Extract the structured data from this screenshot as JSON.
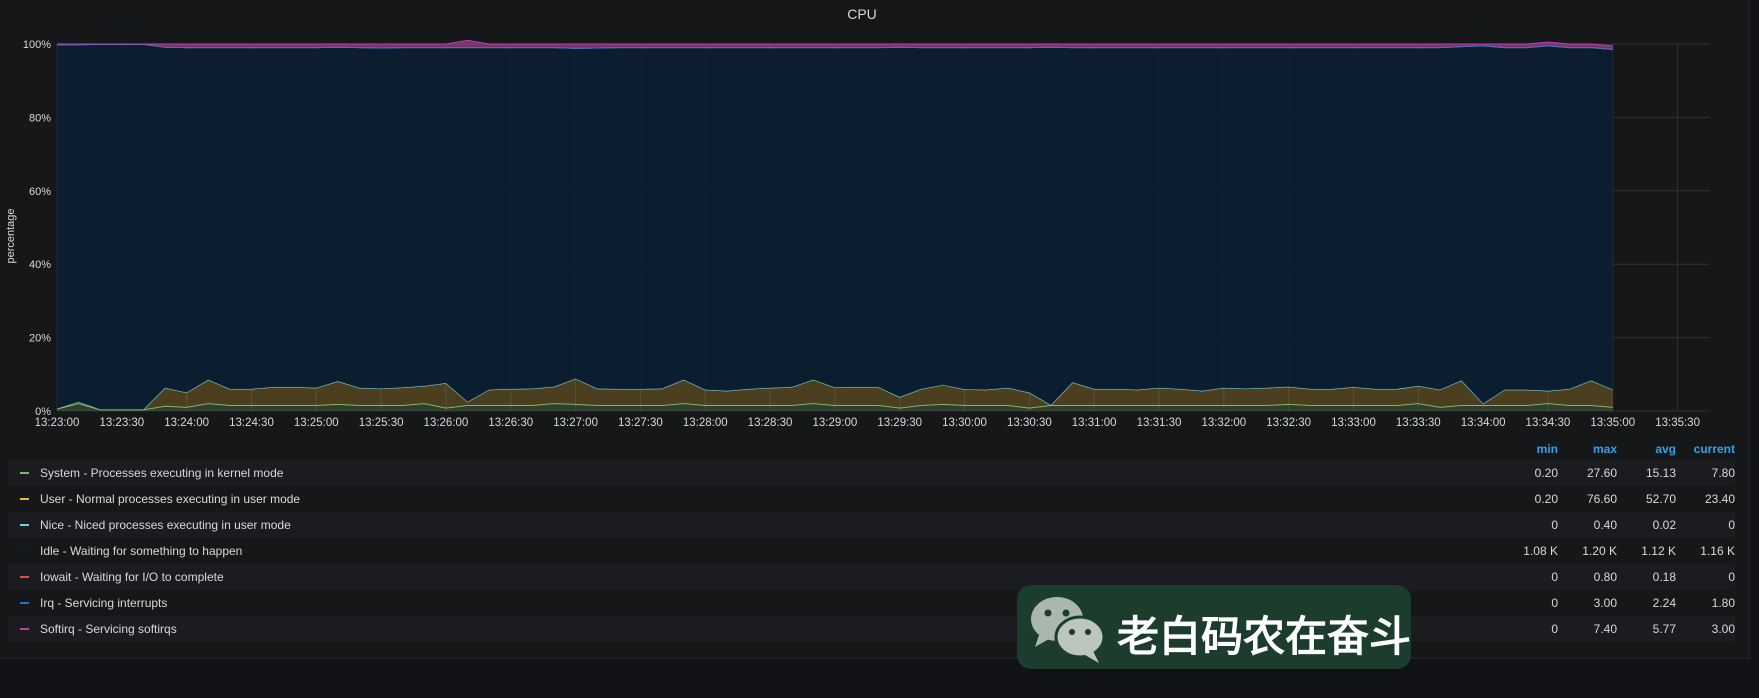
{
  "panel": {
    "title": "CPU"
  },
  "chart_data": {
    "type": "area",
    "title": "CPU",
    "ylabel": "percentage",
    "xlabel": "",
    "ylim": [
      0,
      100
    ],
    "yticks": [
      "0%",
      "20%",
      "40%",
      "60%",
      "80%",
      "100%"
    ],
    "xticks": [
      "13:23:00",
      "13:23:30",
      "13:24:00",
      "13:24:30",
      "13:25:00",
      "13:25:30",
      "13:26:00",
      "13:26:30",
      "13:27:00",
      "13:27:30",
      "13:28:00",
      "13:28:30",
      "13:29:00",
      "13:29:30",
      "13:30:00",
      "13:30:30",
      "13:31:00",
      "13:31:30",
      "13:32:00",
      "13:32:30",
      "13:33:00",
      "13:33:30",
      "13:34:00",
      "13:34:30",
      "13:35:00",
      "13:35:30"
    ],
    "x_start": "13:23:00",
    "x_end": "13:35:45",
    "x_step_seconds": 10,
    "stacked": true,
    "grid": true,
    "series": [
      {
        "name": "System - Processes executing in kernel mode",
        "color": "#7eb26d",
        "values": [
          0.5,
          2.0,
          0.3,
          0.3,
          0.3,
          1.3,
          1.0,
          2.0,
          1.5,
          1.5,
          1.5,
          1.5,
          1.5,
          1.8,
          1.5,
          1.5,
          1.5,
          2.0,
          0.8,
          1.5,
          1.5,
          1.5,
          1.5,
          2.0,
          1.8,
          1.5,
          1.5,
          1.5,
          1.5,
          2.0,
          1.5,
          1.5,
          1.5,
          1.5,
          1.5,
          2.0,
          1.5,
          1.5,
          1.5,
          0.8,
          1.5,
          1.8,
          1.5,
          1.5,
          1.5,
          0.8,
          1.5,
          1.5,
          1.5,
          1.5,
          1.5,
          1.5,
          1.5,
          1.5,
          1.5,
          1.5,
          1.5,
          1.8,
          1.5,
          1.5,
          1.5,
          1.5,
          1.5,
          2.0,
          1.0,
          1.5,
          1.5,
          1.5,
          1.5,
          2.0,
          1.5,
          1.5,
          1.0
        ]
      },
      {
        "name": "User - Normal processes executing in user mode",
        "color": "#eab839",
        "values": [
          0.1,
          0.5,
          0.1,
          0.1,
          0.1,
          5.0,
          4.0,
          6.5,
          4.5,
          4.5,
          5.0,
          5.0,
          4.8,
          6.3,
          4.8,
          4.6,
          4.9,
          4.8,
          6.8,
          1.0,
          4.3,
          4.5,
          4.6,
          4.6,
          7.0,
          4.6,
          4.5,
          4.5,
          4.6,
          6.5,
          4.3,
          4.0,
          4.5,
          4.8,
          5.0,
          6.5,
          4.9,
          5.0,
          5.0,
          3.0,
          4.5,
          5.3,
          4.4,
          4.3,
          4.8,
          4.2,
          0.1,
          6.3,
          4.5,
          4.5,
          4.3,
          4.8,
          4.5,
          4.0,
          4.8,
          4.6,
          4.8,
          4.8,
          4.5,
          4.5,
          5.0,
          4.5,
          4.5,
          4.8,
          4.8,
          6.8,
          0.5,
          4.3,
          4.3,
          3.5,
          4.5,
          6.8,
          4.8,
          5.0,
          1.6
        ]
      },
      {
        "name": "Nice - Niced processes executing in user mode",
        "color": "#6ed0e0",
        "values": [
          0,
          0,
          0,
          0,
          0,
          0,
          0,
          0,
          0,
          0,
          0,
          0,
          0,
          0,
          0,
          0,
          0,
          0,
          0,
          0,
          0,
          0,
          0,
          0,
          0,
          0,
          0,
          0,
          0,
          0,
          0,
          0,
          0,
          0,
          0,
          0,
          0,
          0,
          0,
          0,
          0,
          0,
          0,
          0,
          0,
          0,
          0,
          0,
          0,
          0,
          0,
          0,
          0,
          0,
          0,
          0,
          0,
          0,
          0,
          0,
          0,
          0,
          0,
          0,
          0,
          0,
          0,
          0,
          0,
          0,
          0,
          0,
          0,
          0,
          0.1
        ]
      },
      {
        "name": "Idle - Waiting for something to happen",
        "color": "#0a1f33",
        "values": [
          99.2,
          97.3,
          99.5,
          99.5,
          99.5,
          92.8,
          94.0,
          90.5,
          93.0,
          93.0,
          92.5,
          92.5,
          92.7,
          91.0,
          92.7,
          92.8,
          92.6,
          92.2,
          91.4,
          96.5,
          93.2,
          93.0,
          92.9,
          92.4,
          90.0,
          92.8,
          93.0,
          93.0,
          92.9,
          90.5,
          93.2,
          93.5,
          93.0,
          92.7,
          92.5,
          90.5,
          92.6,
          92.5,
          92.5,
          95.3,
          93.0,
          91.9,
          93.1,
          93.2,
          92.7,
          94.0,
          97.5,
          91.2,
          93.0,
          93.0,
          93.2,
          92.7,
          93.0,
          93.5,
          92.7,
          92.9,
          92.7,
          92.4,
          93.0,
          93.0,
          92.5,
          93.0,
          93.0,
          92.2,
          93.2,
          91.0,
          97.5,
          93.2,
          93.2,
          94.0,
          93.0,
          90.7,
          92.7,
          92.5,
          96.4
        ]
      },
      {
        "name": "Iowait - Waiting for I/O to complete",
        "color": "#ef843c",
        "values": [
          0,
          0,
          0,
          0,
          0,
          0,
          0,
          0,
          0,
          0,
          0,
          0,
          0,
          0,
          0,
          0,
          0,
          0,
          0,
          0,
          0,
          0,
          0,
          0,
          0,
          0,
          0,
          0,
          0,
          0,
          0,
          0,
          0,
          0,
          0,
          0,
          0,
          0,
          0,
          0,
          0,
          0,
          0,
          0,
          0,
          0,
          0,
          0,
          0,
          0,
          0,
          0,
          0,
          0,
          0,
          0,
          0,
          0,
          0,
          0,
          0,
          0,
          0,
          0,
          0,
          0,
          0,
          0,
          0,
          0,
          0,
          0,
          0,
          0,
          0
        ]
      },
      {
        "name": "Irq - Servicing interrupts",
        "color": "#1f78c1",
        "values": [
          0,
          0,
          0,
          0,
          0,
          0,
          0,
          0,
          0,
          0,
          0,
          0,
          0,
          0,
          0,
          0,
          0,
          0,
          0,
          0,
          0,
          0,
          0,
          0,
          0,
          0,
          0,
          0,
          0,
          0,
          0,
          0,
          0,
          0,
          0,
          0,
          0,
          0,
          0,
          0,
          0,
          0,
          0,
          0,
          0,
          0,
          0,
          0,
          0,
          0,
          0,
          0,
          0,
          0,
          0,
          0,
          0,
          0,
          0,
          0,
          0,
          0,
          0,
          0,
          0,
          0,
          0,
          0,
          0,
          0,
          0,
          0,
          0,
          0,
          0
        ]
      },
      {
        "name": "Softirq - Servicing softirqs",
        "color": "#ba43a9",
        "values": [
          0.2,
          0.2,
          0.1,
          0.1,
          0.1,
          0.9,
          1.0,
          1.0,
          1.0,
          1.0,
          1.0,
          1.0,
          1.0,
          0.9,
          1.0,
          1.1,
          1.0,
          1.0,
          1.0,
          2.0,
          1.0,
          1.0,
          1.0,
          1.0,
          1.2,
          1.1,
          1.0,
          1.0,
          1.0,
          1.0,
          1.0,
          1.0,
          1.0,
          1.0,
          1.0,
          1.0,
          1.0,
          1.0,
          1.0,
          0.9,
          1.0,
          1.0,
          1.0,
          1.0,
          1.0,
          1.0,
          0.9,
          1.0,
          1.0,
          1.0,
          1.0,
          1.0,
          1.0,
          1.0,
          1.0,
          1.0,
          1.0,
          1.0,
          1.0,
          1.0,
          1.0,
          1.0,
          1.0,
          1.0,
          1.0,
          0.7,
          0.5,
          1.0,
          1.0,
          1.0,
          1.0,
          1.0,
          1.0,
          1.0,
          0.9
        ]
      }
    ]
  },
  "legend": {
    "headers": {
      "min": "min",
      "max": "max",
      "avg": "avg",
      "current": "current"
    },
    "rows": [
      {
        "name": "System - Processes executing in kernel mode",
        "color": "#7eb26d",
        "min": "0.20",
        "max": "27.60",
        "avg": "15.13",
        "current": "7.80"
      },
      {
        "name": "User - Normal processes executing in user mode",
        "color": "#eab839",
        "min": "0.20",
        "max": "76.60",
        "avg": "52.70",
        "current": "23.40"
      },
      {
        "name": "Nice - Niced processes executing in user mode",
        "color": "#6ed0e0",
        "min": "0",
        "max": "0.40",
        "avg": "0.02",
        "current": "0"
      },
      {
        "name": "Idle - Waiting for something to happen",
        "color": "#0a1f33",
        "min": "1.08 K",
        "max": "1.20 K",
        "avg": "1.12 K",
        "current": "1.16 K"
      },
      {
        "name": "Iowait - Waiting for I/O to complete",
        "color": "#e24d42",
        "min": "0",
        "max": "0.80",
        "avg": "0.18",
        "current": "0"
      },
      {
        "name": "Irq - Servicing interrupts",
        "color": "#1f78c1",
        "min": "0",
        "max": "3.00",
        "avg": "2.24",
        "current": "1.80"
      },
      {
        "name": "Softirq - Servicing softirqs",
        "color": "#ba43a9",
        "min": "0",
        "max": "7.40",
        "avg": "5.77",
        "current": "3.00"
      }
    ]
  },
  "watermark": {
    "text": "老白码农在奋斗",
    "icon": "wechat-icon"
  }
}
